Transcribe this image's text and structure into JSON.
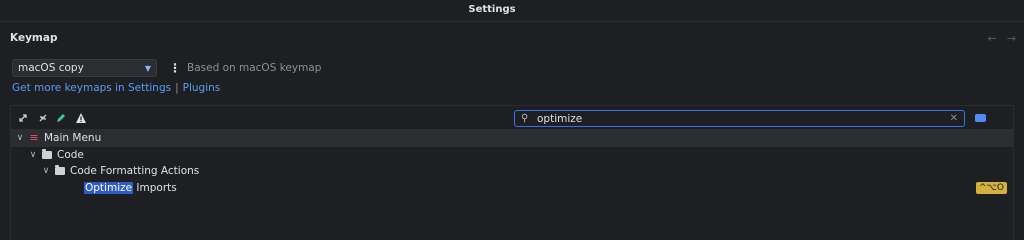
{
  "window": {
    "title": "Settings"
  },
  "page": {
    "heading": "Keymap"
  },
  "keymap": {
    "selected": "macOS copy",
    "based_on": "Based on macOS keymap"
  },
  "links": {
    "get_more": "Get more keymaps in Settings",
    "separator": "|",
    "plugins": "Plugins"
  },
  "toolbar": {
    "icons": [
      "expand-all-icon",
      "collapse-all-icon",
      "edit-icon",
      "warning-icon"
    ]
  },
  "search": {
    "value": "optimize",
    "highlight_color": "#2e5bc8"
  },
  "tree": {
    "main_menu": "Main Menu",
    "code": "Code",
    "code_formatting": "Code Formatting Actions",
    "action": {
      "match": "Optimize",
      "rest": " Imports",
      "shortcut": "^⌥O"
    }
  },
  "colors": {
    "accent": "#3574f0",
    "link": "#589df6",
    "shortcut_badge": "#d4b13d",
    "menu_icon": "#e5556b"
  }
}
